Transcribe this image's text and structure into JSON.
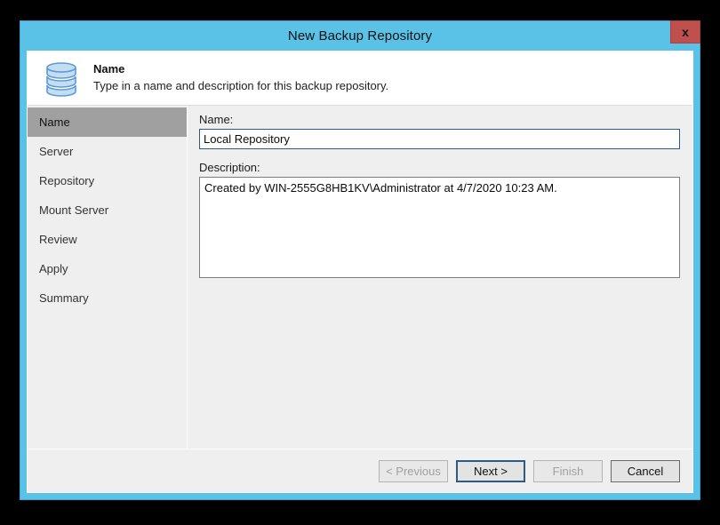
{
  "window": {
    "title": "New Backup Repository",
    "close_label": "x",
    "close_icon": "close-icon"
  },
  "header": {
    "icon": "database-repository-icon",
    "title": "Name",
    "subtitle": "Type in a name and description for this backup repository."
  },
  "sidebar": {
    "items": [
      {
        "label": "Name",
        "selected": true
      },
      {
        "label": "Server",
        "selected": false
      },
      {
        "label": "Repository",
        "selected": false
      },
      {
        "label": "Mount Server",
        "selected": false
      },
      {
        "label": "Review",
        "selected": false
      },
      {
        "label": "Apply",
        "selected": false
      },
      {
        "label": "Summary",
        "selected": false
      }
    ]
  },
  "form": {
    "name_label": "Name:",
    "name_value": "Local Repository",
    "description_label": "Description:",
    "description_value": "Created by WIN-2555G8HB1KV\\Administrator at 4/7/2020 10:23 AM."
  },
  "buttons": {
    "previous": "< Previous",
    "next": "Next >",
    "finish": "Finish",
    "cancel": "Cancel"
  },
  "colors": {
    "window_chrome": "#5bc2e7",
    "close_button": "#c0504d",
    "selection": "#a0a0a0",
    "body_background": "#efefef",
    "focus_border": "#2b5c87",
    "icon_fill": "#c5ddf0",
    "icon_stroke": "#5b9bd5"
  }
}
